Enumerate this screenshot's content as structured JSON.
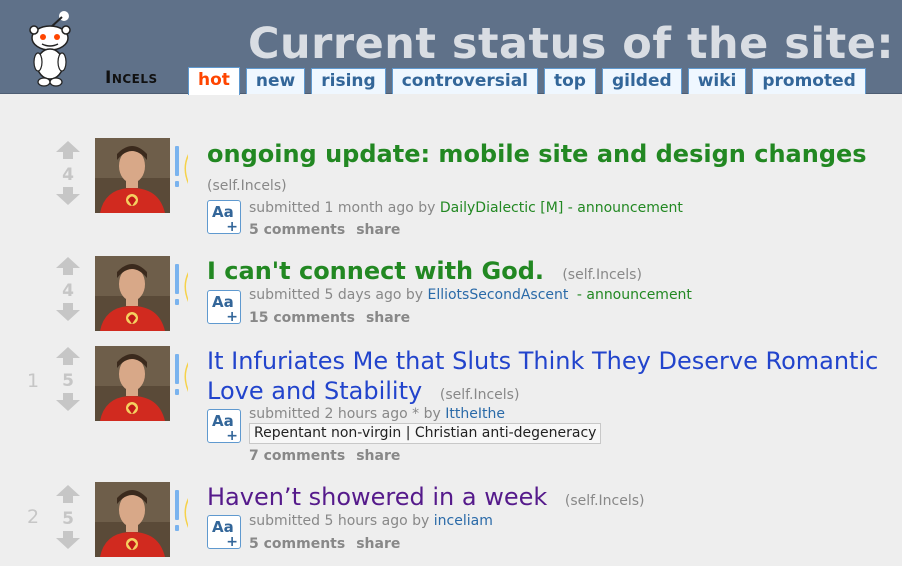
{
  "header": {
    "subreddit_name": "Incels",
    "banner_text": "Current status of the site:",
    "tabs": [
      "hot",
      "new",
      "rising",
      "controversial",
      "top",
      "gilded",
      "wiki",
      "promoted"
    ],
    "active_tab": "hot"
  },
  "posts": [
    {
      "rank": "",
      "score": "4",
      "title": "ongoing update: mobile site and design changes",
      "domain": "(self.Incels)",
      "submitted": "submitted 1 month ago by",
      "author": "DailyDialectic",
      "mod_tag": "[M]",
      "flair_suffix": "- announcement",
      "comments": "5 comments",
      "share": "share"
    },
    {
      "rank": "",
      "score": "4",
      "title": "I can't connect with God.",
      "domain": "(self.Incels)",
      "submitted": "submitted 5 days ago by",
      "author": "ElliotsSecondAscent",
      "flair_suffix": "- announcement",
      "comments": "15 comments",
      "share": "share"
    },
    {
      "rank": "1",
      "score": "5",
      "title_line1": "It Infuriates Me that Sluts Think They Deserve Romantic",
      "title_line2": "Love and Stability",
      "domain": "(self.Incels)",
      "submitted": "submitted 2 hours ago * by",
      "author": "IttheIthe",
      "author_flair": "Repentant non-virgin | Christian anti-degeneracy",
      "comments": "7 comments",
      "share": "share"
    },
    {
      "rank": "2",
      "score": "5",
      "title": "Haven’t showered in a week",
      "domain": "(self.Incels)",
      "submitted": "submitted 5 hours ago by",
      "author": "inceliam",
      "comments": "5 comments",
      "share": "share"
    }
  ],
  "colors": {
    "header_bg": "#5f7189",
    "banner_text": "#d9dde3",
    "tab_link": "#336699",
    "tab_active": "#ff4500",
    "sticky_title": "#228822",
    "link_title": "#2244cc",
    "visited_title": "#551a8b",
    "author_link": "#2a6aa8"
  },
  "icons": {
    "logo": "snoo-alien-icon",
    "upvote": "upvote-arrow-icon",
    "downvote": "downvote-arrow-icon",
    "expando": "text-expando-icon",
    "thumbnail": "avatar-thumbnail"
  }
}
